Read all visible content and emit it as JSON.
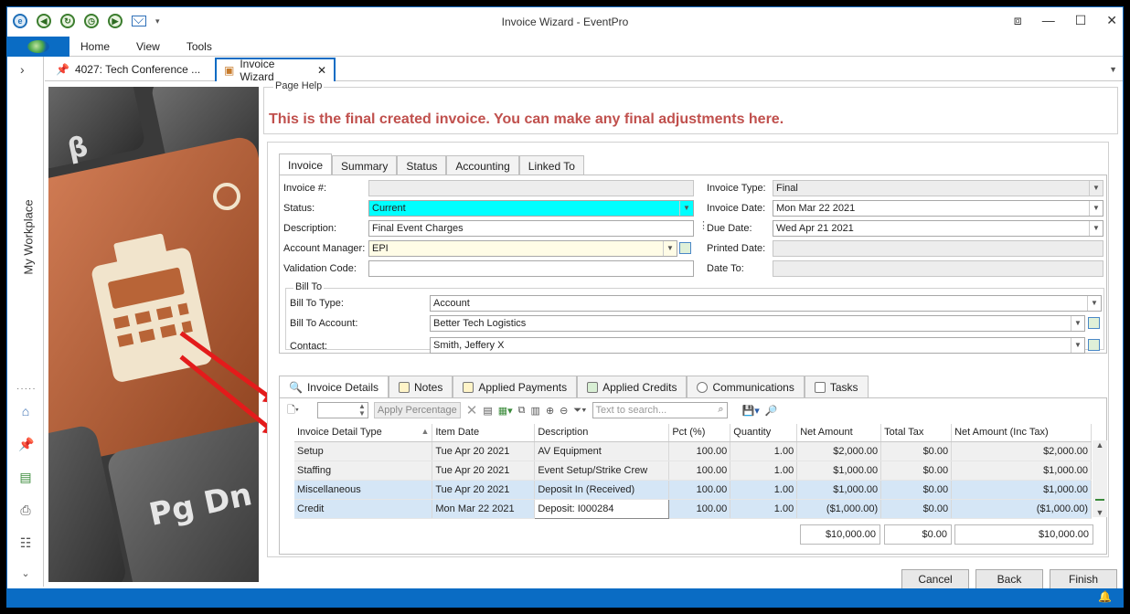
{
  "window": {
    "title": "Invoice Wizard - EventPro"
  },
  "ribbon": {
    "tabs": [
      "Home",
      "View",
      "Tools"
    ]
  },
  "sidebar": {
    "label": "My Workplace"
  },
  "doc_tabs": [
    {
      "label": "4027: Tech Conference ..."
    },
    {
      "label": "Invoice Wizard"
    }
  ],
  "page_help": {
    "legend": "Page Help",
    "message": "This is the final created invoice.  You can make any final adjustments here."
  },
  "invoice_tabs": [
    "Invoice",
    "Summary",
    "Status",
    "Accounting",
    "Linked To"
  ],
  "form": {
    "invoice_no_label": "Invoice #:",
    "invoice_no": "",
    "status_label": "Status:",
    "status": "Current",
    "description_label": "Description:",
    "description": "Final Event Charges",
    "account_manager_label": "Account Manager:",
    "account_manager": "EPI",
    "validation_code_label": "Validation Code:",
    "validation_code": "",
    "invoice_type_label": "Invoice Type:",
    "invoice_type": "Final",
    "invoice_date_label": "Invoice Date:",
    "invoice_date": "Mon Mar 22 2021",
    "due_date_label": "Due Date:",
    "due_date": "Wed Apr 21 2021",
    "printed_date_label": "Printed Date:",
    "printed_date": "",
    "date_to_label": "Date To:",
    "date_to": ""
  },
  "bill_to": {
    "legend": "Bill To",
    "type_label": "Bill To Type:",
    "type": "Account",
    "account_label": "Bill To Account:",
    "account": "Better Tech Logistics",
    "contact_label": "Contact:",
    "contact": "Smith, Jeffery X"
  },
  "detail_tabs": [
    "Invoice Details",
    "Notes",
    "Applied Payments",
    "Applied Credits",
    "Communications",
    "Tasks"
  ],
  "toolbar": {
    "apply_percentage": "Apply Percentage",
    "search_placeholder": "Text to search..."
  },
  "grid": {
    "columns": [
      "Invoice Detail Type",
      "Item Date",
      "Description",
      "Pct (%)",
      "Quantity",
      "Net Amount",
      "Total Tax",
      "Net Amount (Inc Tax)"
    ],
    "rows": [
      [
        "Setup",
        "Tue Apr 20 2021",
        "AV Equipment",
        "100.00",
        "1.00",
        "$2,000.00",
        "$0.00",
        "$2,000.00"
      ],
      [
        "Staffing",
        "Tue Apr 20 2021",
        "Event Setup/Strike Crew",
        "100.00",
        "1.00",
        "$1,000.00",
        "$0.00",
        "$1,000.00"
      ],
      [
        "Miscellaneous",
        "Tue Apr 20 2021",
        "Deposit In (Received)",
        "100.00",
        "1.00",
        "$1,000.00",
        "$0.00",
        "$1,000.00"
      ],
      [
        "Credit",
        "Mon Mar 22 2021",
        "Deposit: I000284",
        "100.00",
        "1.00",
        "($1,000.00)",
        "$0.00",
        "($1,000.00)"
      ]
    ],
    "totals": {
      "net": "$10,000.00",
      "tax": "$0.00",
      "net_inc_tax": "$10,000.00"
    }
  },
  "buttons": {
    "cancel": "Cancel",
    "back": "Back",
    "finish": "Finish"
  },
  "colors": {
    "accent": "#0a6cc4",
    "help_text": "#c0504d",
    "status_highlight": "#00ffff",
    "arrow": "#e31b1b"
  }
}
